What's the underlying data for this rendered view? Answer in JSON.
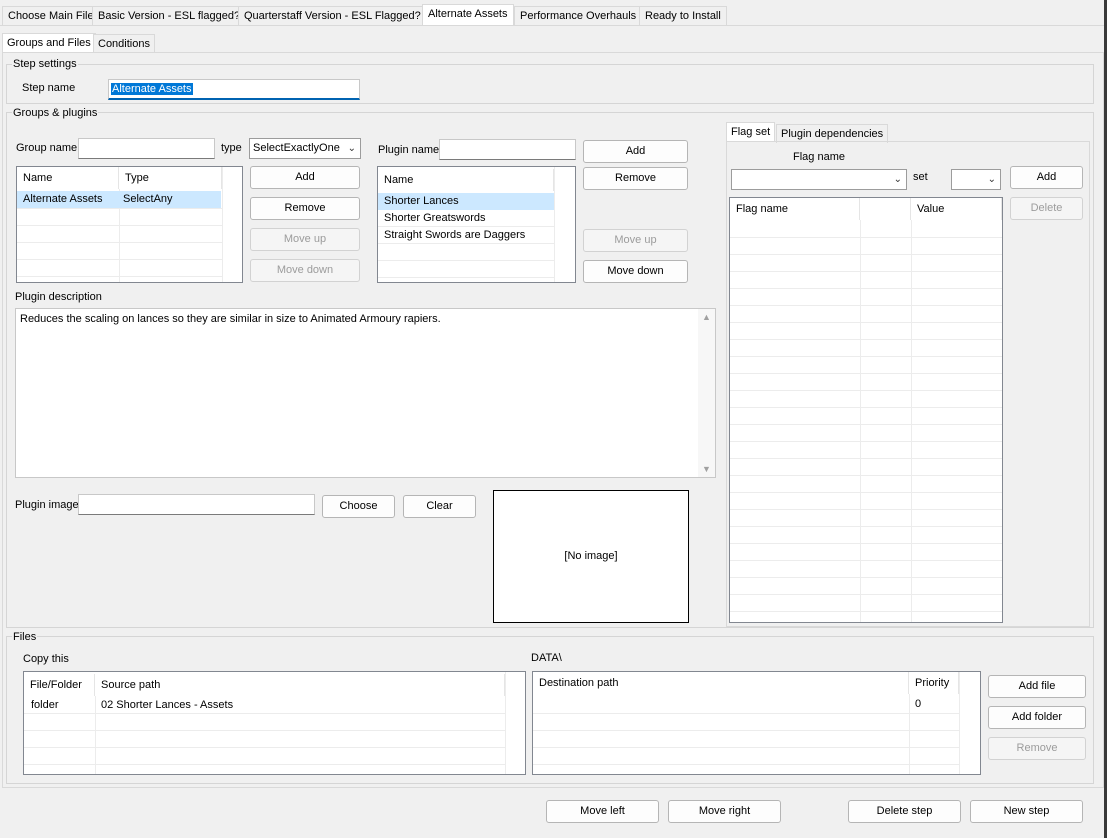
{
  "main_tabs": [
    "Choose Main File",
    "Basic Version - ESL flagged?",
    "Quarterstaff Version - ESL Flagged?",
    "Alternate Assets",
    "Performance Overhauls",
    "Ready to Install"
  ],
  "sub_tabs": [
    "Groups and Files",
    "Conditions"
  ],
  "step_settings": {
    "title": "Step settings",
    "step_name_label": "Step name",
    "step_name_value": "Alternate Assets"
  },
  "groups_plugins": {
    "title": "Groups & plugins",
    "group_name_label": "Group name",
    "group_name_value": "",
    "type_label": "type",
    "type_value": "SelectExactlyOne",
    "groups_table": {
      "headers": [
        "Name",
        "Type"
      ],
      "rows": [
        [
          "Alternate Assets",
          "SelectAny"
        ]
      ]
    },
    "group_buttons": {
      "add": "Add",
      "remove": "Remove",
      "move_up": "Move up",
      "move_down": "Move down"
    },
    "plugin_name_label": "Plugin name",
    "plugin_name_value": "",
    "plugins_table": {
      "header": "Name",
      "rows": [
        "Shorter Lances",
        "Shorter Greatswords",
        "Straight Swords are Daggers"
      ]
    },
    "plugin_buttons": {
      "add": "Add",
      "remove": "Remove",
      "move_up": "Move up",
      "move_down": "Move down"
    },
    "description_label": "Plugin description",
    "description_text": "Reduces the scaling on lances so they are similar in size to Animated Armoury rapiers.",
    "image_label": "Plugin image",
    "image_value": "",
    "choose_label": "Choose",
    "clear_label": "Clear",
    "no_image_text": "[No image]"
  },
  "flags": {
    "tabs": [
      "Flag set",
      "Plugin dependencies"
    ],
    "flag_name_label": "Flag name",
    "set_label": "set",
    "add_label": "Add",
    "delete_label": "Delete",
    "table_headers": [
      "Flag name",
      "",
      "Value"
    ]
  },
  "files": {
    "title": "Files",
    "copy_label": "Copy this",
    "data_label": "DATA\\",
    "source_headers": [
      "File/Folder",
      "Source path"
    ],
    "source_rows": [
      [
        "folder",
        "02 Shorter Lances - Assets"
      ]
    ],
    "dest_headers": [
      "Destination path",
      "Priority"
    ],
    "dest_rows": [
      [
        "",
        "0"
      ]
    ],
    "add_file": "Add file",
    "add_folder": "Add folder",
    "remove": "Remove"
  },
  "footer": {
    "move_left": "Move left",
    "move_right": "Move right",
    "delete_step": "Delete step",
    "new_step": "New step"
  }
}
